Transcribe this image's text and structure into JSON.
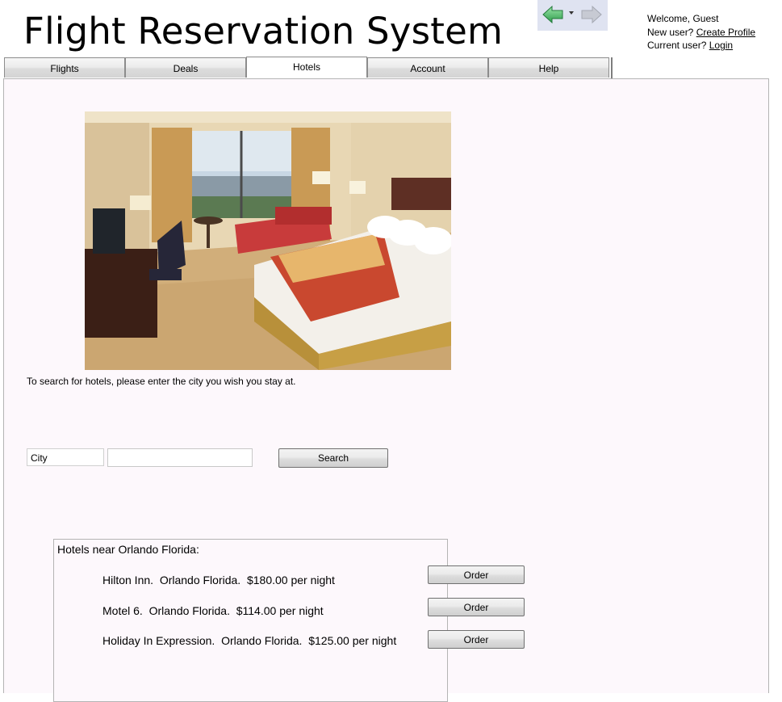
{
  "app": {
    "title": "Flight Reservation System"
  },
  "navigation": {
    "back_icon": "back-arrow-icon",
    "dropdown_icon": "dropdown-arrow-icon",
    "forward_icon": "forward-arrow-icon"
  },
  "user": {
    "welcome": "Welcome, Guest",
    "new_user_prefix": "New user?",
    "create_profile": "Create Profile",
    "current_user_prefix": "Current user?",
    "login": "Login"
  },
  "tabs": [
    {
      "label": "Flights",
      "active": false
    },
    {
      "label": "Deals",
      "active": false
    },
    {
      "label": "Hotels",
      "active": true
    },
    {
      "label": "Account",
      "active": false
    },
    {
      "label": "Help",
      "active": false
    }
  ],
  "hotels_page": {
    "instruction": "To search for hotels, please enter the city you wish you stay at.",
    "city_label": "City",
    "city_value": "",
    "search_label": "Search",
    "results_heading": "Hotels near Orlando Florida:",
    "results": [
      {
        "text": "Hilton Inn.  Orlando Florida.  $180.00 per night",
        "order_label": "Order"
      },
      {
        "text": "Motel 6.  Orlando Florida.  $114.00 per night",
        "order_label": "Order"
      },
      {
        "text": "Holiday In Expression.  Orlando Florida.  $125.00 per night",
        "order_label": "Order"
      }
    ]
  },
  "colors": {
    "panel_bg": "#fdf8fc",
    "nav_bg": "#dfe3f1",
    "back_arrow": "#5cc07a"
  }
}
